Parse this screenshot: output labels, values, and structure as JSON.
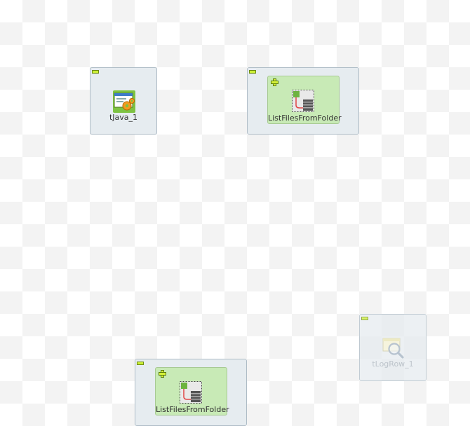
{
  "canvas": {
    "components": [
      {
        "label": "tJava_1",
        "icon": "java-gear-icon",
        "state": "active"
      },
      {
        "label": "ListFilesFromFolder",
        "icon": "joblet-icon",
        "state": "active",
        "type": "subjob"
      },
      {
        "label": "tLogRow_1",
        "icon": "magnifier-log-icon",
        "state": "deactivated"
      },
      {
        "label": "ListFilesFromFolder",
        "icon": "joblet-icon",
        "state": "active",
        "type": "subjob"
      }
    ]
  },
  "colors": {
    "node_bg": "#e6ecf0",
    "node_border": "#aebcc6",
    "subjob_bg": "#c8eab6",
    "toggle_green": "#cbef36"
  }
}
